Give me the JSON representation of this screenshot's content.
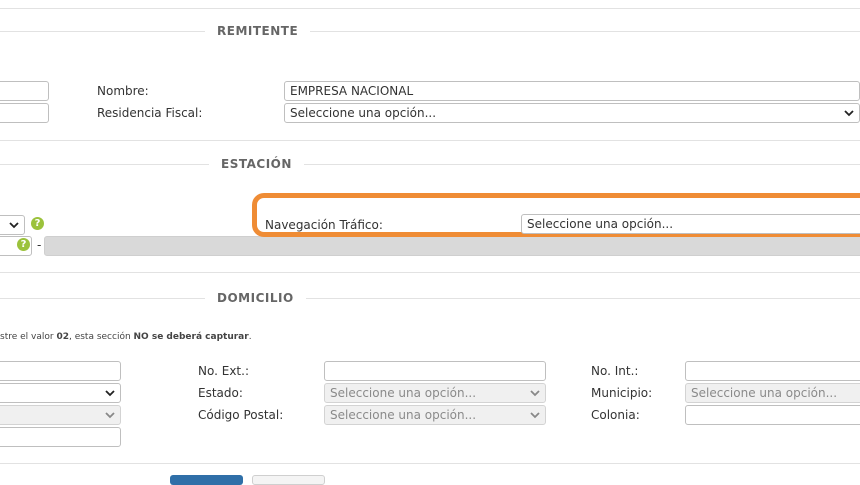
{
  "sections": {
    "remitente": "REMITENTE",
    "estacion": "ESTACIÓN",
    "domicilio": "DOMICILIO"
  },
  "remitente": {
    "nombre_label": "Nombre:",
    "nombre_value": "EMPRESA NACIONAL",
    "residencia_label": "Residencia Fiscal:",
    "residencia_value": "Seleccione una opción..."
  },
  "estacion": {
    "navegacion_label": "Navegación Tráfico:",
    "navegacion_value": "Seleccione una opción...",
    "separator": "-"
  },
  "domicilio": {
    "note_prefix": "stre el valor ",
    "note_value": "02",
    "note_middle": ", esta sección ",
    "note_emphasis": "NO se deberá capturar",
    "note_end": ".",
    "no_ext_label": "No. Ext.:",
    "no_int_label": "No. Int.:",
    "estado_label": "Estado:",
    "estado_value": "Seleccione una opción...",
    "municipio_label": "Municipio:",
    "municipio_value": "Seleccione una opción...",
    "cp_label": "Código Postal:",
    "cp_value": "Seleccione una opción...",
    "colonia_label": "Colonia:"
  },
  "help_icon": "?",
  "colors": {
    "highlight": "#ef8c35",
    "help": "#9bc23c",
    "primary_button": "#2f6fa8"
  }
}
